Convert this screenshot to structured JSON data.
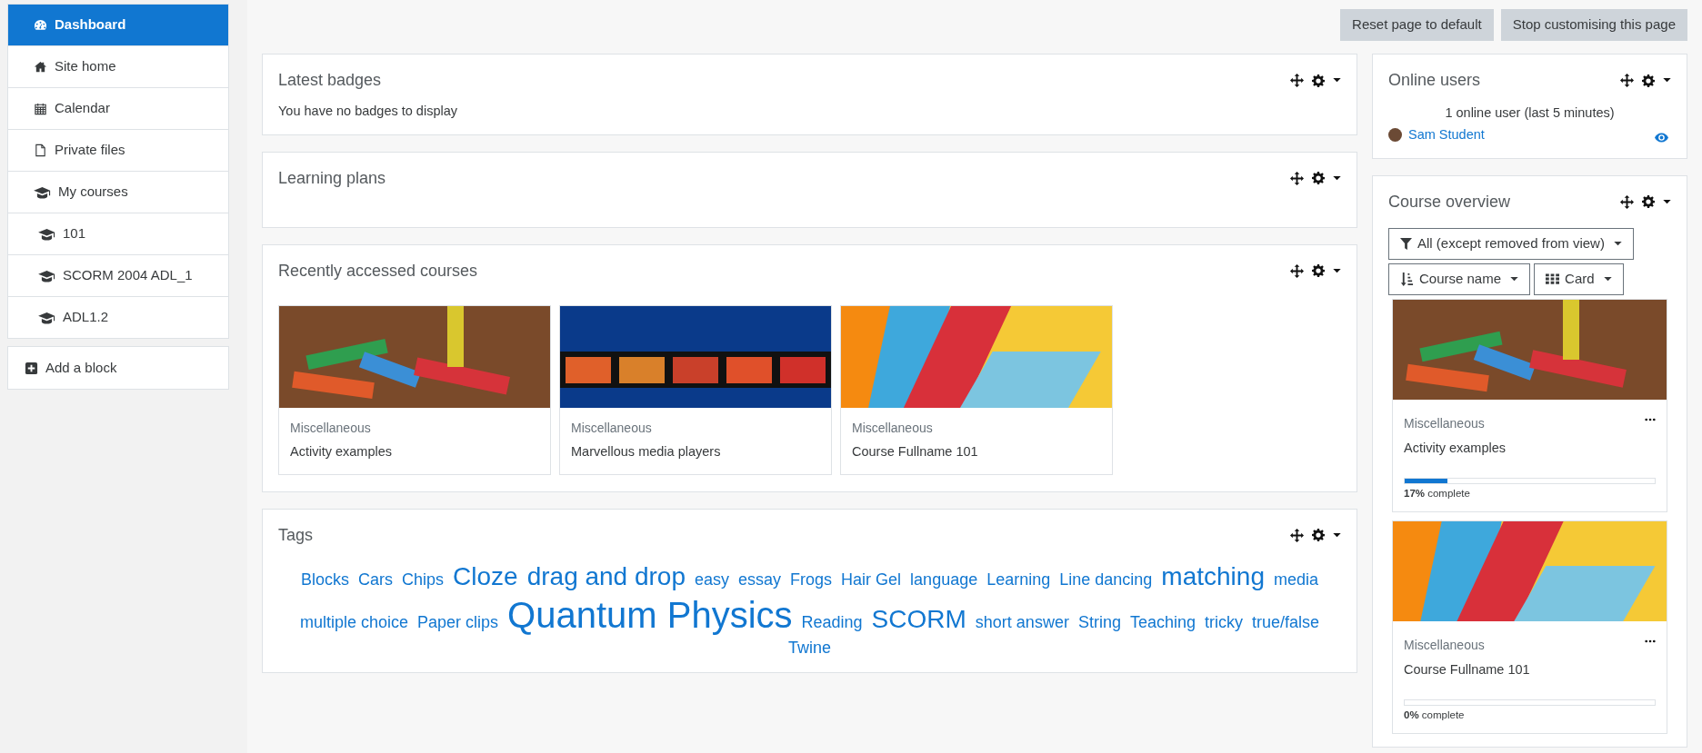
{
  "sidebar": {
    "items": [
      {
        "label": "Dashboard",
        "kind": "dashboard",
        "selected": true
      },
      {
        "label": "Site home",
        "kind": "home",
        "selected": false
      },
      {
        "label": "Calendar",
        "kind": "calendar",
        "selected": false
      },
      {
        "label": "Private files",
        "kind": "file",
        "selected": false
      },
      {
        "label": "My courses",
        "kind": "cap",
        "selected": false,
        "children": [
          {
            "label": "101",
            "kind": "cap",
            "selected": false
          },
          {
            "label": "SCORM 2004 ADL_1",
            "kind": "cap",
            "selected": false
          },
          {
            "label": "ADL1.2",
            "kind": "cap",
            "selected": false
          }
        ]
      }
    ],
    "add_block": "Add a block"
  },
  "header_buttons": [
    "Reset page to default",
    "Stop customising this page"
  ],
  "main_blocks": [
    {
      "kind": "text",
      "title": "Latest badges",
      "text": "You have no badges to display"
    },
    {
      "kind": "empty",
      "title": "Learning plans"
    },
    {
      "kind": "courses",
      "title": "Recently accessed courses",
      "courses": [
        {
          "kind": "blocks",
          "category": "Miscellaneous",
          "name": "Activity examples"
        },
        {
          "kind": "film",
          "category": "Miscellaneous",
          "name": "Marvellous media players"
        },
        {
          "kind": "paper",
          "category": "Miscellaneous",
          "name": "Course Fullname 101"
        }
      ]
    },
    {
      "kind": "tags",
      "title": "Tags",
      "tags": [
        {
          "label": "Blocks",
          "kind": "small"
        },
        {
          "label": "Cars",
          "kind": "small"
        },
        {
          "label": "Chips",
          "kind": "small"
        },
        {
          "label": "Cloze",
          "kind": "large"
        },
        {
          "label": "drag and drop",
          "kind": "large"
        },
        {
          "label": "easy",
          "kind": "small"
        },
        {
          "label": "essay",
          "kind": "small"
        },
        {
          "label": "Frogs",
          "kind": "small"
        },
        {
          "label": "Hair Gel",
          "kind": "small"
        },
        {
          "label": "language",
          "kind": "small"
        },
        {
          "label": "Learning",
          "kind": "small"
        },
        {
          "label": "Line dancing",
          "kind": "small"
        },
        {
          "label": "matching",
          "kind": "large"
        },
        {
          "label": "media",
          "kind": "small"
        },
        {
          "label": "multiple choice",
          "kind": "small"
        },
        {
          "label": "Paper clips",
          "kind": "small"
        },
        {
          "label": "Quantum Physics",
          "kind": "huge"
        },
        {
          "label": "Reading",
          "kind": "small"
        },
        {
          "label": "SCORM",
          "kind": "large"
        },
        {
          "label": "short answer",
          "kind": "small"
        },
        {
          "label": "String",
          "kind": "small"
        },
        {
          "label": "Teaching",
          "kind": "small"
        },
        {
          "label": "tricky",
          "kind": "small"
        },
        {
          "label": "true/false",
          "kind": "small"
        },
        {
          "label": "Twine",
          "kind": "small"
        }
      ]
    }
  ],
  "online_users": {
    "title": "Online users",
    "summary": "1 online user (last 5 minutes)",
    "users": [
      {
        "name": "Sam Student"
      }
    ]
  },
  "course_overview": {
    "title": "Course overview",
    "filter": "All (except removed from view)",
    "sort": "Course name",
    "view": "Card",
    "courses": [
      {
        "kind": "blocks",
        "category": "Miscellaneous",
        "name": "Activity examples",
        "level": 0.17,
        "progress": "**17%** complete"
      },
      {
        "kind": "paper",
        "category": "Miscellaneous",
        "name": "Course Fullname 101",
        "level": 0,
        "progress": "**0%** complete"
      }
    ]
  }
}
